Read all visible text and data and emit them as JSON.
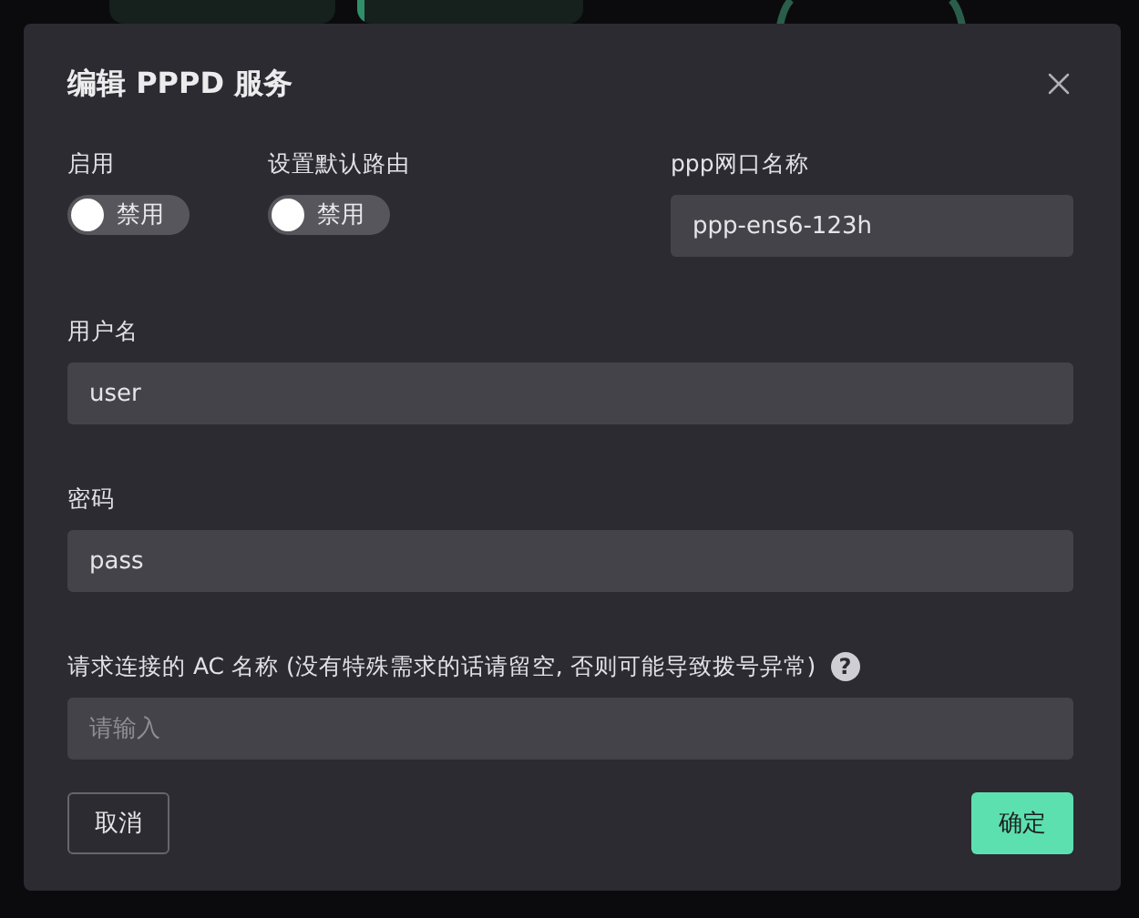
{
  "dialog": {
    "title": "编辑 PPPD 服务",
    "switches": [
      {
        "label": "启用",
        "text": "禁用",
        "on": false
      },
      {
        "label": "设置默认路由",
        "text": "禁用",
        "on": false
      }
    ],
    "interface": {
      "label": "ppp网口名称",
      "value": "ppp-ens6-123h"
    },
    "username": {
      "label": "用户名",
      "value": "user"
    },
    "password": {
      "label": "密码",
      "value": "pass"
    },
    "ac": {
      "label": "请求连接的 AC 名称 (没有特殊需求的话请留空, 否则可能导致拨号异常)",
      "help": "?",
      "placeholder": "请输入"
    },
    "cancel": "取消",
    "ok": "确定"
  }
}
